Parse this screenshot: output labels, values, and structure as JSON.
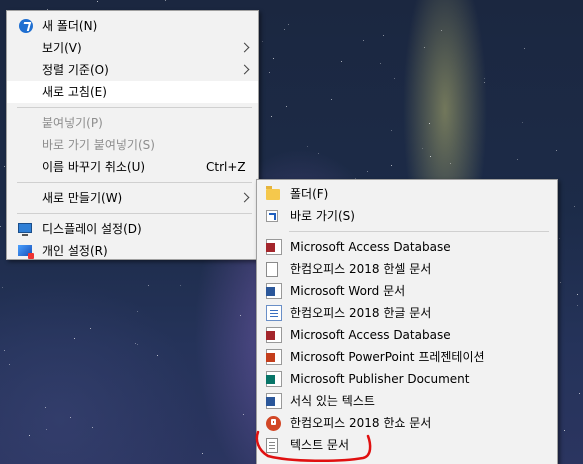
{
  "main_menu": {
    "new_folder": "새 폴더(N)",
    "view": "보기(V)",
    "sort_by": "정렬 기준(O)",
    "refresh": "새로 고침(E)",
    "paste": "붙여넣기(P)",
    "paste_shortcut": "바로 가기 붙여넣기(S)",
    "undo_rename": "이름 바꾸기 취소(U)",
    "undo_rename_shortcut": "Ctrl+Z",
    "new": "새로 만들기(W)",
    "display_settings": "디스플레이 설정(D)",
    "personalize": "개인 설정(R)"
  },
  "sub_menu": {
    "items": [
      {
        "label": "폴더(F)",
        "icon": "folder-icon"
      },
      {
        "label": "바로 가기(S)",
        "icon": "shortcut-icon"
      },
      {
        "label": "Microsoft Access Database",
        "icon": "access-icon"
      },
      {
        "label": "한컴오피스 2018 한셀 문서",
        "icon": "document-icon"
      },
      {
        "label": "Microsoft Word 문서",
        "icon": "word-icon"
      },
      {
        "label": "한컴오피스 2018 한글 문서",
        "icon": "hwp-icon"
      },
      {
        "label": "Microsoft Access Database",
        "icon": "access-icon"
      },
      {
        "label": "Microsoft PowerPoint 프레젠테이션",
        "icon": "powerpoint-icon"
      },
      {
        "label": "Microsoft Publisher Document",
        "icon": "publisher-icon"
      },
      {
        "label": "서식 있는 텍스트",
        "icon": "rich-text-icon"
      },
      {
        "label": "한컴오피스 2018 한쇼 문서",
        "icon": "hanshow-icon"
      },
      {
        "label": "텍스트 문서",
        "icon": "text-document-icon"
      }
    ]
  },
  "colors": {
    "menu_bg": "#f2f2f2",
    "highlight": "#ffffff",
    "disabled_text": "#8e8e8e",
    "annotation": "#e01010"
  }
}
